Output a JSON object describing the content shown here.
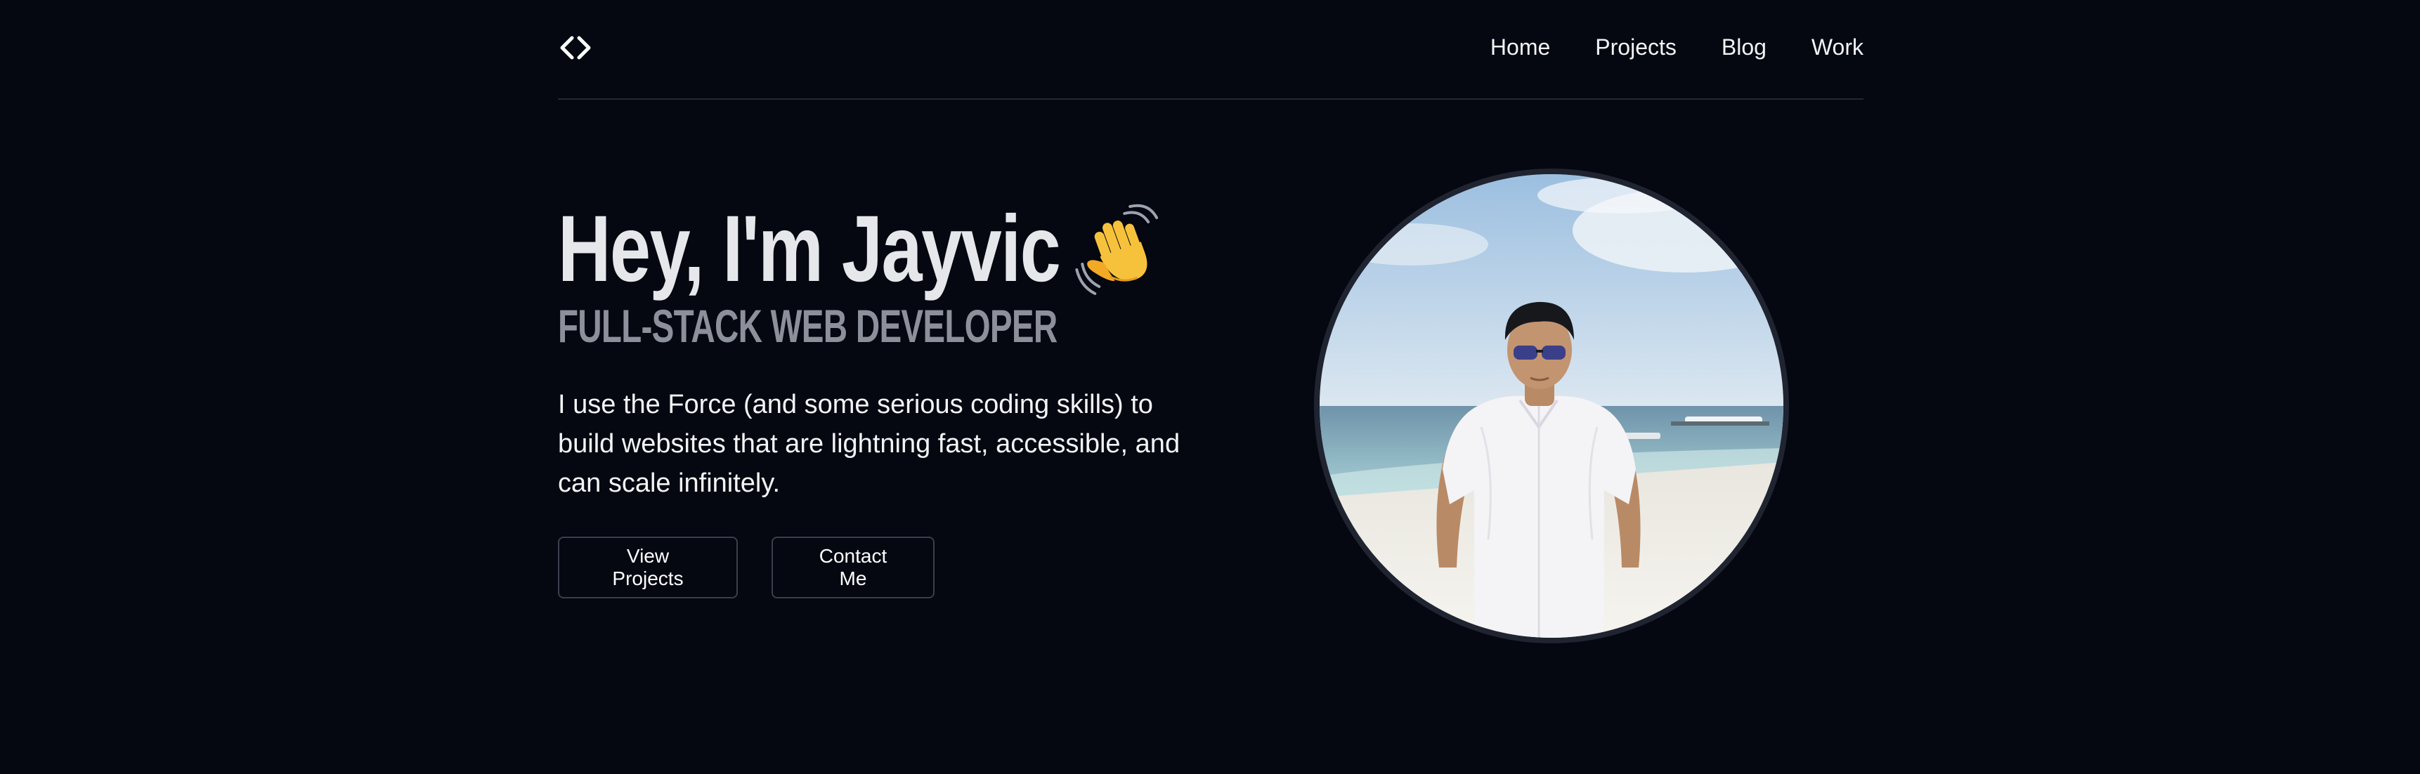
{
  "header": {
    "logo_icon": "code-brackets-icon",
    "nav": [
      {
        "label": "Home"
      },
      {
        "label": "Projects"
      },
      {
        "label": "Blog"
      },
      {
        "label": "Work"
      }
    ]
  },
  "hero": {
    "title": "Hey, I'm Jayvic",
    "title_emoji_icon": "waving-hand-icon",
    "subtitle": "FULL-STACK WEB DEVELOPER",
    "description": "I use the Force (and some serious coding skills) to build websites that are lightning fast, accessible, and can scale infinitely.",
    "buttons": {
      "projects_label": "View Projects",
      "contact_label": "Contact Me"
    }
  },
  "portrait": {
    "image": "profile-photo"
  },
  "colors": {
    "background": "#050711",
    "text": "#f3f4f6",
    "subtitle": "#8b909b",
    "divider": "#242836",
    "button_border": "#3a3f4d"
  }
}
